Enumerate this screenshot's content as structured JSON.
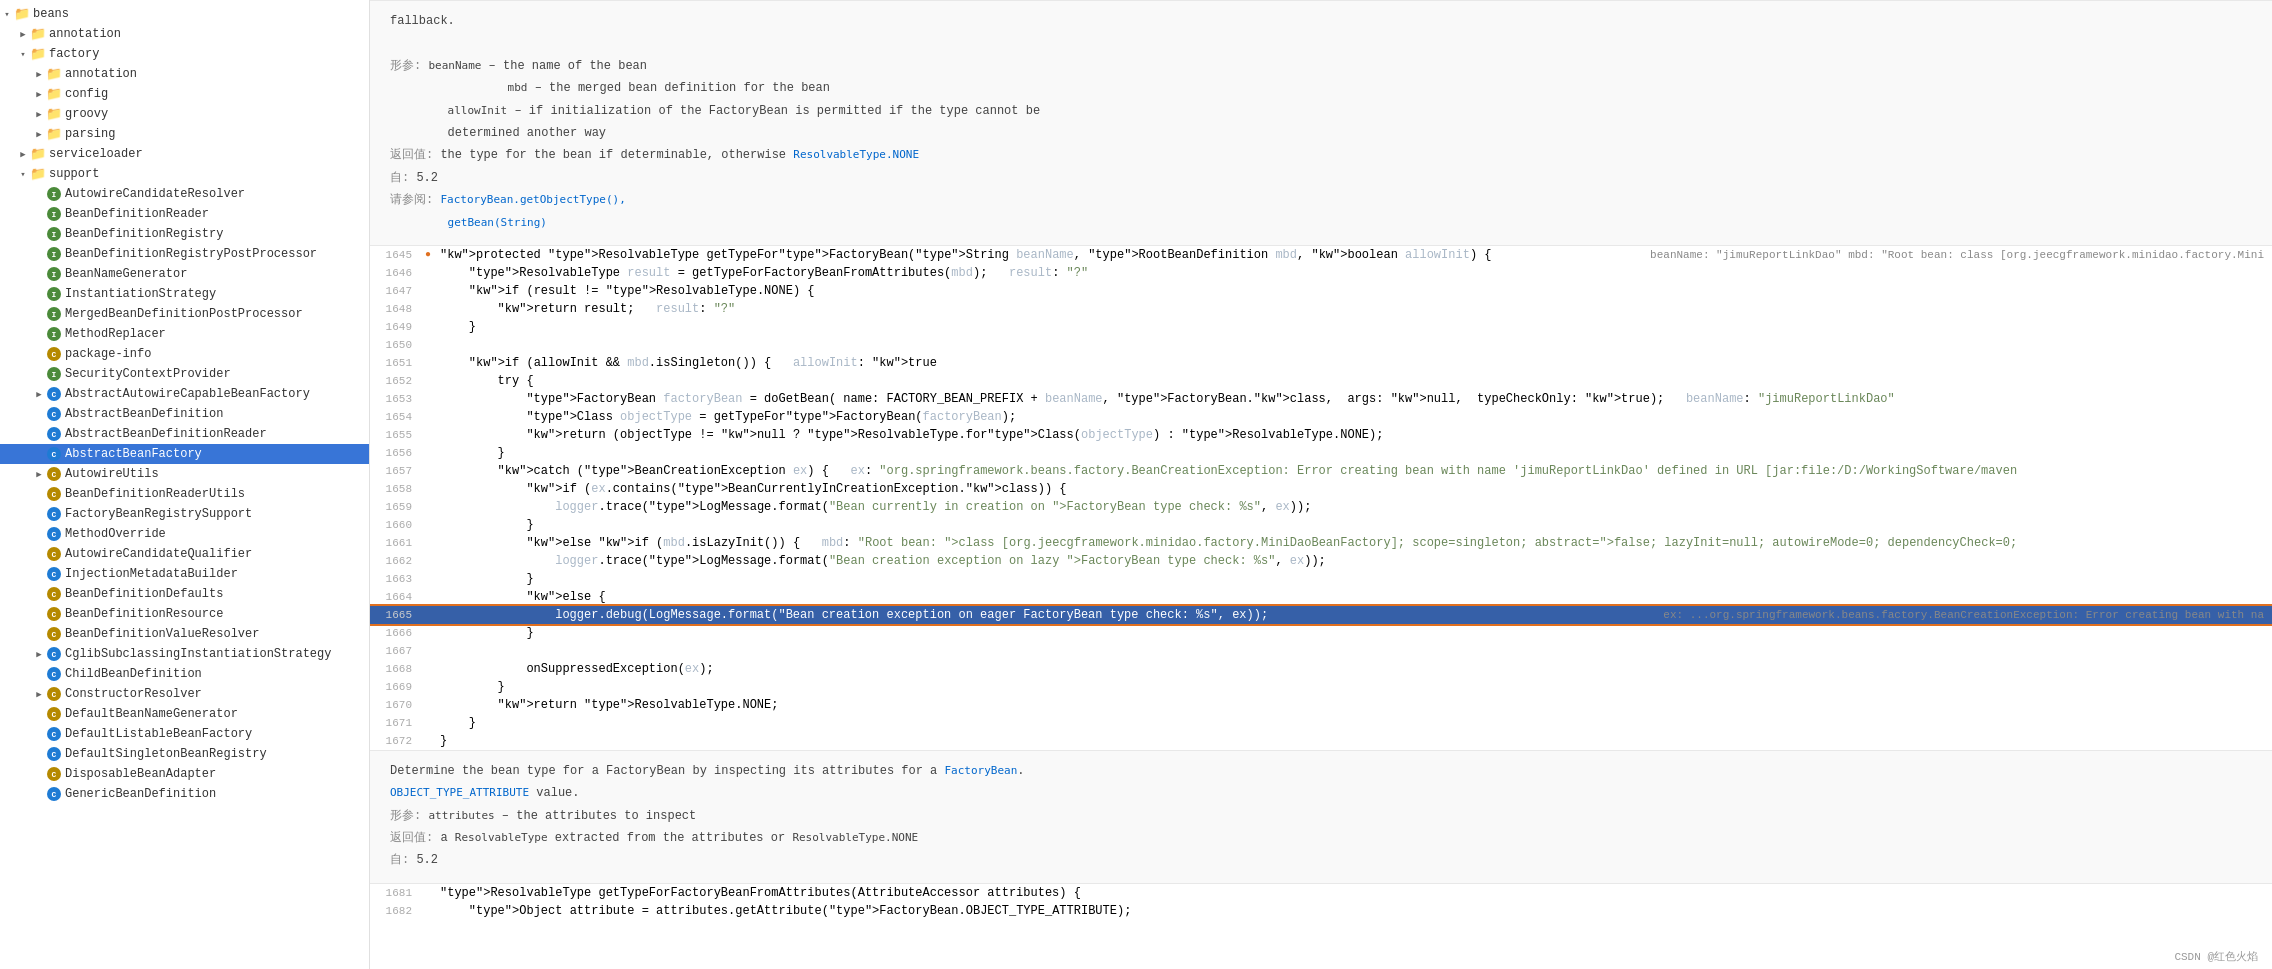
{
  "sidebar": {
    "items": [
      {
        "id": "beans",
        "label": "beans",
        "level": 0,
        "type": "folder",
        "expanded": true,
        "arrow": "▾"
      },
      {
        "id": "annotation",
        "label": "annotation",
        "level": 1,
        "type": "folder",
        "expanded": false,
        "arrow": "▶"
      },
      {
        "id": "factory",
        "label": "factory",
        "level": 1,
        "type": "folder",
        "expanded": true,
        "arrow": "▾"
      },
      {
        "id": "annotation2",
        "label": "annotation",
        "level": 2,
        "type": "folder",
        "expanded": false,
        "arrow": "▶"
      },
      {
        "id": "config",
        "label": "config",
        "level": 2,
        "type": "folder",
        "expanded": false,
        "arrow": "▶"
      },
      {
        "id": "groovy",
        "label": "groovy",
        "level": 2,
        "type": "folder",
        "expanded": false,
        "arrow": "▶"
      },
      {
        "id": "parsing",
        "label": "parsing",
        "level": 2,
        "type": "folder",
        "expanded": false,
        "arrow": "▶"
      },
      {
        "id": "serviceloader",
        "label": "serviceloader",
        "level": 1,
        "type": "folder",
        "expanded": false,
        "arrow": "▶"
      },
      {
        "id": "support",
        "label": "support",
        "level": 1,
        "type": "folder",
        "expanded": true,
        "arrow": "▾"
      },
      {
        "id": "AutowireCandidateResolver",
        "label": "AutowireCandidateResolver",
        "level": 2,
        "type": "interface",
        "arrow": ""
      },
      {
        "id": "BeanDefinitionReader",
        "label": "BeanDefinitionReader",
        "level": 2,
        "type": "interface",
        "arrow": ""
      },
      {
        "id": "BeanDefinitionRegistry",
        "label": "BeanDefinitionRegistry",
        "level": 2,
        "type": "interface",
        "arrow": ""
      },
      {
        "id": "BeanDefinitionRegistryPostProcessor",
        "label": "BeanDefinitionRegistryPostProcessor",
        "level": 2,
        "type": "interface",
        "arrow": ""
      },
      {
        "id": "BeanNameGenerator",
        "label": "BeanNameGenerator",
        "level": 2,
        "type": "interface",
        "arrow": ""
      },
      {
        "id": "InstantiationStrategy",
        "label": "InstantiationStrategy",
        "level": 2,
        "type": "interface",
        "arrow": ""
      },
      {
        "id": "MergedBeanDefinitionPostProcessor",
        "label": "MergedBeanDefinitionPostProcessor",
        "level": 2,
        "type": "interface",
        "arrow": ""
      },
      {
        "id": "MethodReplacer",
        "label": "MethodReplacer",
        "level": 2,
        "type": "interface",
        "arrow": ""
      },
      {
        "id": "package-info",
        "label": "package-info",
        "level": 2,
        "type": "class",
        "arrow": ""
      },
      {
        "id": "SecurityContextProvider",
        "label": "SecurityContextProvider",
        "level": 2,
        "type": "interface",
        "arrow": ""
      },
      {
        "id": "AbstractAutowireCapableBeanFactory",
        "label": "AbstractAutowireCapableBeanFactory",
        "level": 2,
        "type": "class_sub",
        "arrow": "▶"
      },
      {
        "id": "AbstractBeanDefinition",
        "label": "AbstractBeanDefinition",
        "level": 2,
        "type": "class_sub",
        "arrow": ""
      },
      {
        "id": "AbstractBeanDefinitionReader",
        "label": "AbstractBeanDefinitionReader",
        "level": 2,
        "type": "class_sub",
        "arrow": ""
      },
      {
        "id": "AbstractBeanFactory",
        "label": "AbstractBeanFactory",
        "level": 2,
        "type": "class_sub",
        "arrow": "",
        "selected": true
      },
      {
        "id": "AutowireUtils",
        "label": "AutowireUtils",
        "level": 2,
        "type": "class",
        "arrow": "▶"
      },
      {
        "id": "BeanDefinitionReaderUtils",
        "label": "BeanDefinitionReaderUtils",
        "level": 2,
        "type": "class",
        "arrow": ""
      },
      {
        "id": "FactoryBeanRegistrySupport",
        "label": "FactoryBeanRegistrySupport",
        "level": 2,
        "type": "class_sub",
        "arrow": ""
      },
      {
        "id": "MethodOverride",
        "label": "MethodOverride",
        "level": 2,
        "type": "class_sub",
        "arrow": ""
      },
      {
        "id": "AutowireCandidateQualifier",
        "label": "AutowireCandidateQualifier",
        "level": 2,
        "type": "class",
        "arrow": ""
      },
      {
        "id": "InjectionMetadataBuilder",
        "label": "InjectionMetadataBuilder",
        "level": 2,
        "type": "class_sub",
        "arrow": ""
      },
      {
        "id": "BeanDefinitionDefaults",
        "label": "BeanDefinitionDefaults",
        "level": 2,
        "type": "class",
        "arrow": ""
      },
      {
        "id": "BeanDefinitionResource",
        "label": "BeanDefinitionResource",
        "level": 2,
        "type": "class",
        "arrow": ""
      },
      {
        "id": "BeanDefinitionValueResolver",
        "label": "BeanDefinitionValueResolver",
        "level": 2,
        "type": "class",
        "arrow": ""
      },
      {
        "id": "CglibSubclassingInstantiationStrategy",
        "label": "CglibSubclassingInstantiationStrategy",
        "level": 2,
        "type": "class_sub",
        "arrow": "▶"
      },
      {
        "id": "ChildBeanDefinition",
        "label": "ChildBeanDefinition",
        "level": 2,
        "type": "class_sub",
        "arrow": ""
      },
      {
        "id": "ConstructorResolver",
        "label": "ConstructorResolver",
        "level": 2,
        "type": "class",
        "arrow": "▶"
      },
      {
        "id": "DefaultBeanNameGenerator",
        "label": "DefaultBeanNameGenerator",
        "level": 2,
        "type": "class",
        "arrow": ""
      },
      {
        "id": "DefaultListableBeanFactory",
        "label": "DefaultListableBeanFactory",
        "level": 2,
        "type": "class_sub",
        "arrow": ""
      },
      {
        "id": "DefaultSingletonBeanRegistry",
        "label": "DefaultSingletonBeanRegistry",
        "level": 2,
        "type": "class_sub",
        "arrow": ""
      },
      {
        "id": "DisposableBeanAdapter",
        "label": "DisposableBeanAdapter",
        "level": 2,
        "type": "class",
        "arrow": ""
      },
      {
        "id": "GenericBeanDefinition",
        "label": "GenericBeanDefinition",
        "level": 2,
        "type": "class_sub",
        "arrow": ""
      }
    ]
  },
  "code": {
    "doc_header": {
      "lines": [
        "fallback.",
        "",
        "形参:   beanName – the name of the bean",
        "        mbd – the merged bean definition for the bean",
        "        allowInit – if initialization of the FactoryBean is permitted if the type cannot be",
        "        determined another way",
        "返回值: the type for the bean if determinable, otherwise ResolvableType.NONE",
        "自:    5.2",
        "请参阅: FactoryBean.getObjectType(),",
        "        getBean(String)"
      ]
    },
    "lines": [
      {
        "num": 1645,
        "debug": true,
        "indent": 2,
        "content": "protected ResolvableType getTypeForFactoryBean(String beanName, RootBeanDefinition mbd, boolean allowInit) {",
        "debug_info": "  beanName: \"jimuReportLinkDao\"   mbd: \"Root bean: class [org.jeecgframework.minidao.factory.Mini",
        "selected": false
      },
      {
        "num": 1646,
        "indent": 3,
        "content": "    ResolvableType result = getTypeForFactoryBeanFromAttributes(mbd);   result: \"?\"",
        "selected": false
      },
      {
        "num": 1647,
        "indent": 3,
        "content": "    if (result != ResolvableType.NONE) {",
        "selected": false
      },
      {
        "num": 1648,
        "indent": 4,
        "content": "        return result;   result: \"?\"",
        "selected": false
      },
      {
        "num": 1649,
        "indent": 4,
        "content": "    }",
        "selected": false
      },
      {
        "num": 1650,
        "indent": 3,
        "content": "",
        "selected": false
      },
      {
        "num": 1651,
        "indent": 3,
        "content": "    if (allowInit && mbd.isSingleton()) {   allowInit: true",
        "selected": false
      },
      {
        "num": 1652,
        "indent": 4,
        "content": "        try {",
        "selected": false
      },
      {
        "num": 1653,
        "indent": 5,
        "content": "            FactoryBean<?> factoryBean = doGetBean( name: FACTORY_BEAN_PREFIX + beanName, FactoryBean.class,  args: null,  typeCheckOnly: true);   beanName: \"jimuReportLinkDao\"",
        "selected": false
      },
      {
        "num": 1654,
        "indent": 5,
        "content": "            Class<?> objectType = getTypeForFactoryBean(factoryBean);",
        "selected": false
      },
      {
        "num": 1655,
        "indent": 5,
        "content": "            return (objectType != null ? ResolvableType.forClass(objectType) : ResolvableType.NONE);",
        "selected": false
      },
      {
        "num": 1656,
        "indent": 4,
        "content": "        }",
        "selected": false
      },
      {
        "num": 1657,
        "indent": 4,
        "content": "        catch (BeanCreationException ex) {   ex: \"org.springframework.beans.factory.BeanCreationException: Error creating bean with name 'jimuReportLinkDao' defined in URL [jar:file:/D:/WorkingSoftware/maven",
        "selected": false
      },
      {
        "num": 1658,
        "indent": 5,
        "content": "            if (ex.contains(BeanCurrentlyInCreationException.class)) {",
        "selected": false
      },
      {
        "num": 1659,
        "indent": 6,
        "content": "                logger.trace(LogMessage.format(\"Bean currently in creation on FactoryBean type check: %s\", ex));",
        "selected": false
      },
      {
        "num": 1660,
        "indent": 5,
        "content": "            }",
        "selected": false
      },
      {
        "num": 1661,
        "indent": 5,
        "content": "            else if (mbd.isLazyInit()) {   mbd: \"Root bean: class [org.jeecgframework.minidao.factory.MiniDaoBeanFactory]; scope=singleton; abstract=false; lazyInit=null; autowireMode=0; dependencyCheck=0;",
        "selected": false
      },
      {
        "num": 1662,
        "indent": 6,
        "content": "                logger.trace(LogMessage.format(\"Bean creation exception on lazy FactoryBean type check: %s\", ex));",
        "selected": false
      },
      {
        "num": 1663,
        "indent": 5,
        "content": "            }",
        "selected": false
      },
      {
        "num": 1664,
        "indent": 5,
        "content": "            else {",
        "selected": false
      },
      {
        "num": 1665,
        "indent": 6,
        "content": "                logger.debug(LogMessage.format(\"Bean creation exception on eager FactoryBean type check: %s\", ex));",
        "selected": true,
        "debug_right": "  ex: ...org.springframework.beans.factory.BeanCreationException: Error creating bean with na"
      },
      {
        "num": 1666,
        "indent": 5,
        "content": "            }",
        "selected": false
      },
      {
        "num": 1667,
        "indent": 5,
        "content": "",
        "selected": false
      },
      {
        "num": 1668,
        "indent": 5,
        "content": "            onSuppressedException(ex);",
        "selected": false
      },
      {
        "num": 1669,
        "indent": 4,
        "content": "        }",
        "selected": false
      },
      {
        "num": 1670,
        "indent": 3,
        "content": "        return ResolvableType.NONE;",
        "selected": false
      },
      {
        "num": 1671,
        "indent": 2,
        "content": "    }",
        "selected": false
      },
      {
        "num": 1672,
        "indent": 2,
        "content": "}",
        "selected": false
      }
    ],
    "doc_footer": {
      "lines": [
        "Determine the bean type for a FactoryBean by inspecting its attributes for a FactoryBean.",
        "OBJECT_TYPE_ATTRIBUTE value.",
        "形参:   attributes – the attributes to inspect",
        "返回值: a ResolvableType extracted from the attributes or ResolvableType.NONE",
        "自:    5.2"
      ]
    },
    "bottom_lines": [
      {
        "num": 1681,
        "content": "ResolvableType getTypeForFactoryBeanFromAttributes(AttributeAccessor attributes) {"
      },
      {
        "num": 1682,
        "content": "    Object attribute = attributes.getAttribute(FactoryBean.OBJECT_TYPE_ATTRIBUTE);"
      }
    ]
  },
  "watermark": "CSDN @红色火焰"
}
